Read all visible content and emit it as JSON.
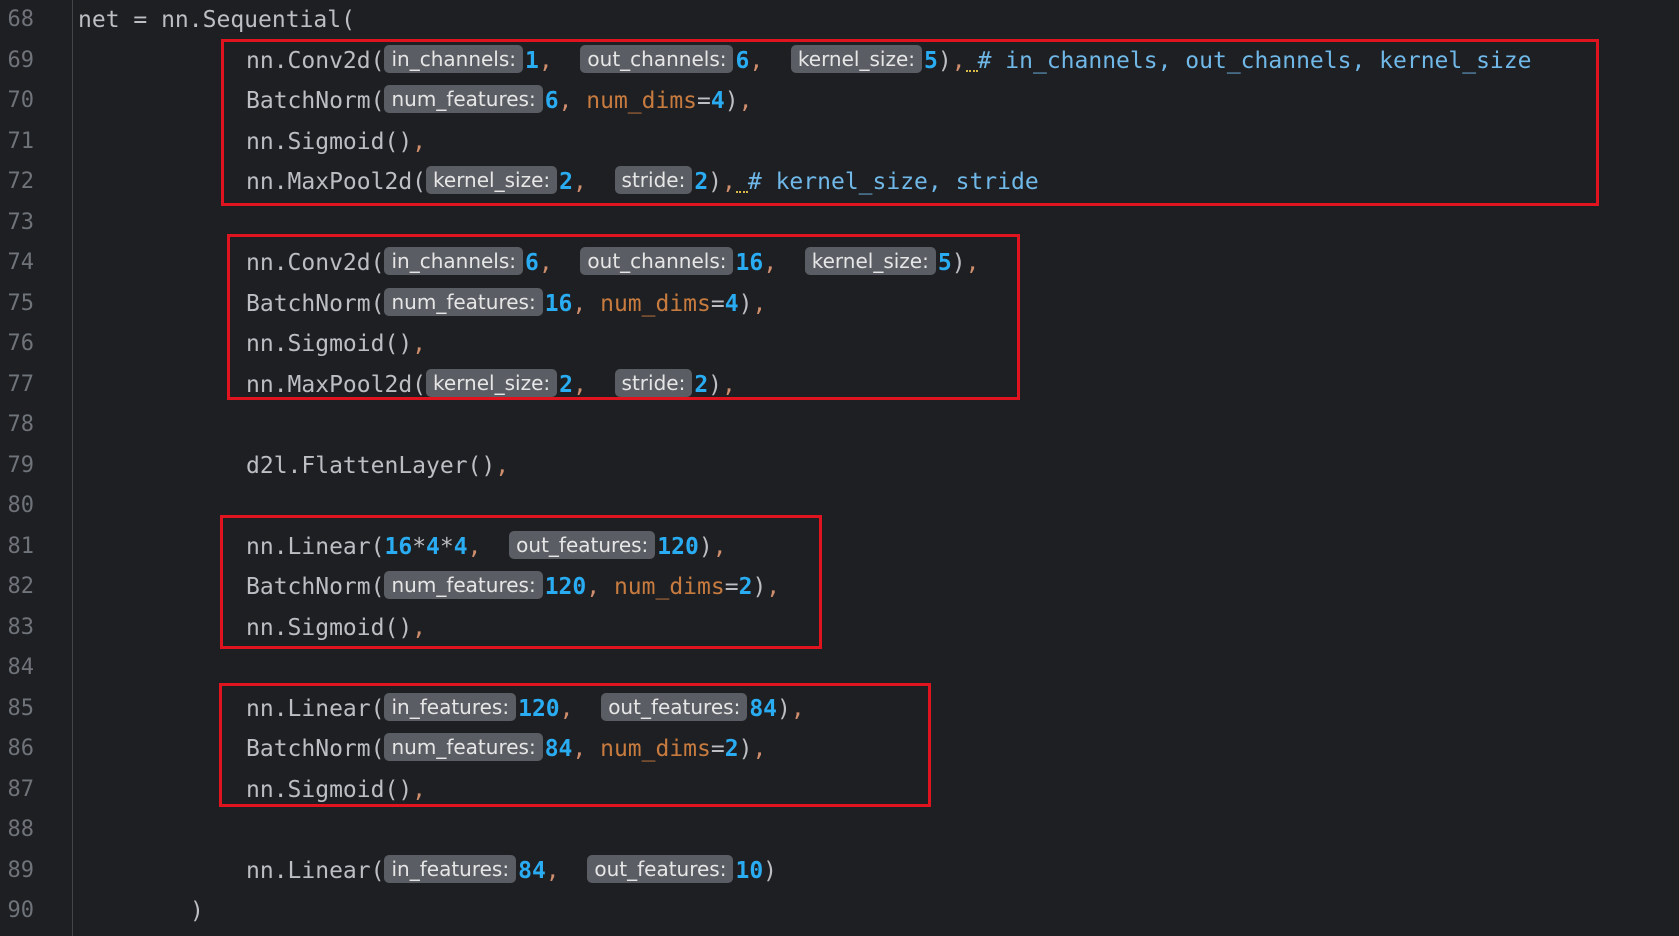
{
  "editor": {
    "lines": [
      {
        "n": "68",
        "indent": 0,
        "tokens": [
          {
            "t": "plain",
            "v": "net = nn.Sequential("
          }
        ]
      },
      {
        "n": "69",
        "indent": 1,
        "tokens": [
          {
            "t": "plain",
            "v": "nn.Conv2d("
          },
          {
            "t": "hint",
            "v": "in_channels:"
          },
          {
            "t": "num",
            "v": "1"
          },
          {
            "t": "comma",
            "v": ",  "
          },
          {
            "t": "hint",
            "v": "out_channels:"
          },
          {
            "t": "num",
            "v": "6"
          },
          {
            "t": "comma",
            "v": ",  "
          },
          {
            "t": "hint",
            "v": "kernel_size:"
          },
          {
            "t": "num",
            "v": "5"
          },
          {
            "t": "plain",
            "v": ")"
          },
          {
            "t": "comma",
            "v": ","
          },
          {
            "t": "warn",
            "v": ""
          },
          {
            "t": "comment",
            "v": "# in_channels, out_channels, kernel_size"
          }
        ]
      },
      {
        "n": "70",
        "indent": 1,
        "tokens": [
          {
            "t": "plain",
            "v": "BatchNorm("
          },
          {
            "t": "hint",
            "v": "num_features:"
          },
          {
            "t": "num",
            "v": "6"
          },
          {
            "t": "comma",
            "v": ", "
          },
          {
            "t": "kw",
            "v": "num_dims"
          },
          {
            "t": "plain",
            "v": "="
          },
          {
            "t": "num",
            "v": "4"
          },
          {
            "t": "plain",
            "v": ")"
          },
          {
            "t": "comma",
            "v": ","
          }
        ]
      },
      {
        "n": "71",
        "indent": 1,
        "tokens": [
          {
            "t": "plain",
            "v": "nn.Sigmoid()"
          },
          {
            "t": "comma",
            "v": ","
          }
        ]
      },
      {
        "n": "72",
        "indent": 1,
        "tokens": [
          {
            "t": "plain",
            "v": "nn.MaxPool2d("
          },
          {
            "t": "hint",
            "v": "kernel_size:"
          },
          {
            "t": "num",
            "v": "2"
          },
          {
            "t": "comma",
            "v": ",  "
          },
          {
            "t": "hint",
            "v": "stride:"
          },
          {
            "t": "num",
            "v": "2"
          },
          {
            "t": "plain",
            "v": ")"
          },
          {
            "t": "comma",
            "v": ","
          },
          {
            "t": "warn",
            "v": ""
          },
          {
            "t": "comment",
            "v": "# kernel_size, stride"
          }
        ]
      },
      {
        "n": "73",
        "indent": 0,
        "tokens": []
      },
      {
        "n": "74",
        "indent": 1,
        "tokens": [
          {
            "t": "plain",
            "v": "nn.Conv2d("
          },
          {
            "t": "hint",
            "v": "in_channels:"
          },
          {
            "t": "num",
            "v": "6"
          },
          {
            "t": "comma",
            "v": ",  "
          },
          {
            "t": "hint",
            "v": "out_channels:"
          },
          {
            "t": "num",
            "v": "16"
          },
          {
            "t": "comma",
            "v": ",  "
          },
          {
            "t": "hint",
            "v": "kernel_size:"
          },
          {
            "t": "num",
            "v": "5"
          },
          {
            "t": "plain",
            "v": ")"
          },
          {
            "t": "comma",
            "v": ","
          }
        ]
      },
      {
        "n": "75",
        "indent": 1,
        "tokens": [
          {
            "t": "plain",
            "v": "BatchNorm("
          },
          {
            "t": "hint",
            "v": "num_features:"
          },
          {
            "t": "num",
            "v": "16"
          },
          {
            "t": "comma",
            "v": ", "
          },
          {
            "t": "kw",
            "v": "num_dims"
          },
          {
            "t": "plain",
            "v": "="
          },
          {
            "t": "num",
            "v": "4"
          },
          {
            "t": "plain",
            "v": ")"
          },
          {
            "t": "comma",
            "v": ","
          }
        ]
      },
      {
        "n": "76",
        "indent": 1,
        "tokens": [
          {
            "t": "plain",
            "v": "nn.Sigmoid()"
          },
          {
            "t": "comma",
            "v": ","
          }
        ]
      },
      {
        "n": "77",
        "indent": 1,
        "tokens": [
          {
            "t": "plain",
            "v": "nn.MaxPool2d("
          },
          {
            "t": "hint",
            "v": "kernel_size:"
          },
          {
            "t": "num",
            "v": "2"
          },
          {
            "t": "comma",
            "v": ",  "
          },
          {
            "t": "hint",
            "v": "stride:"
          },
          {
            "t": "num",
            "v": "2"
          },
          {
            "t": "plain",
            "v": ")"
          },
          {
            "t": "comma",
            "v": ","
          }
        ]
      },
      {
        "n": "78",
        "indent": 0,
        "tokens": []
      },
      {
        "n": "79",
        "indent": 1,
        "tokens": [
          {
            "t": "plain",
            "v": "d2l.FlattenLayer()"
          },
          {
            "t": "comma",
            "v": ","
          }
        ]
      },
      {
        "n": "80",
        "indent": 0,
        "tokens": []
      },
      {
        "n": "81",
        "indent": 1,
        "tokens": [
          {
            "t": "plain",
            "v": "nn.Linear("
          },
          {
            "t": "num",
            "v": "16"
          },
          {
            "t": "plain",
            "v": "*"
          },
          {
            "t": "num",
            "v": "4"
          },
          {
            "t": "plain",
            "v": "*"
          },
          {
            "t": "num",
            "v": "4"
          },
          {
            "t": "comma",
            "v": ",  "
          },
          {
            "t": "hint",
            "v": "out_features:"
          },
          {
            "t": "num",
            "v": "120"
          },
          {
            "t": "plain",
            "v": ")"
          },
          {
            "t": "comma",
            "v": ","
          }
        ]
      },
      {
        "n": "82",
        "indent": 1,
        "tokens": [
          {
            "t": "plain",
            "v": "BatchNorm("
          },
          {
            "t": "hint",
            "v": "num_features:"
          },
          {
            "t": "num",
            "v": "120"
          },
          {
            "t": "comma",
            "v": ", "
          },
          {
            "t": "kw",
            "v": "num_dims"
          },
          {
            "t": "plain",
            "v": "="
          },
          {
            "t": "num",
            "v": "2"
          },
          {
            "t": "plain",
            "v": ")"
          },
          {
            "t": "comma",
            "v": ","
          }
        ]
      },
      {
        "n": "83",
        "indent": 1,
        "tokens": [
          {
            "t": "plain",
            "v": "nn.Sigmoid()"
          },
          {
            "t": "comma",
            "v": ","
          }
        ]
      },
      {
        "n": "84",
        "indent": 0,
        "tokens": []
      },
      {
        "n": "85",
        "indent": 1,
        "tokens": [
          {
            "t": "plain",
            "v": "nn.Linear("
          },
          {
            "t": "hint",
            "v": "in_features:"
          },
          {
            "t": "num",
            "v": "120"
          },
          {
            "t": "comma",
            "v": ",  "
          },
          {
            "t": "hint",
            "v": "out_features:"
          },
          {
            "t": "num",
            "v": "84"
          },
          {
            "t": "plain",
            "v": ")"
          },
          {
            "t": "comma",
            "v": ","
          }
        ]
      },
      {
        "n": "86",
        "indent": 1,
        "tokens": [
          {
            "t": "plain",
            "v": "BatchNorm("
          },
          {
            "t": "hint",
            "v": "num_features:"
          },
          {
            "t": "num",
            "v": "84"
          },
          {
            "t": "comma",
            "v": ", "
          },
          {
            "t": "kw",
            "v": "num_dims"
          },
          {
            "t": "plain",
            "v": "="
          },
          {
            "t": "num",
            "v": "2"
          },
          {
            "t": "plain",
            "v": ")"
          },
          {
            "t": "comma",
            "v": ","
          }
        ]
      },
      {
        "n": "87",
        "indent": 1,
        "tokens": [
          {
            "t": "plain",
            "v": "nn.Sigmoid()"
          },
          {
            "t": "comma",
            "v": ","
          }
        ]
      },
      {
        "n": "88",
        "indent": 0,
        "tokens": []
      },
      {
        "n": "89",
        "indent": 1,
        "tokens": [
          {
            "t": "plain",
            "v": "nn.Linear("
          },
          {
            "t": "hint",
            "v": "in_features:"
          },
          {
            "t": "num",
            "v": "84"
          },
          {
            "t": "comma",
            "v": ",  "
          },
          {
            "t": "hint",
            "v": "out_features:"
          },
          {
            "t": "num",
            "v": "10"
          },
          {
            "t": "plain",
            "v": ")"
          }
        ]
      },
      {
        "n": "90",
        "indent": 2,
        "tokens": [
          {
            "t": "plain",
            "v": ")"
          }
        ]
      }
    ]
  },
  "colors": {
    "background": "#1e1f22",
    "line_number": "#6f737a",
    "plain": "#bcbec4",
    "number": "#2aacf2",
    "keyword_arg": "#c77b3f",
    "comment": "#6fb8e8",
    "hint_background": "#5a5d63",
    "highlight_box": "#e0141e"
  },
  "highlight_boxes": [
    {
      "name": "conv-block-1"
    },
    {
      "name": "conv-block-2"
    },
    {
      "name": "linear-block-1"
    },
    {
      "name": "linear-block-2"
    }
  ]
}
